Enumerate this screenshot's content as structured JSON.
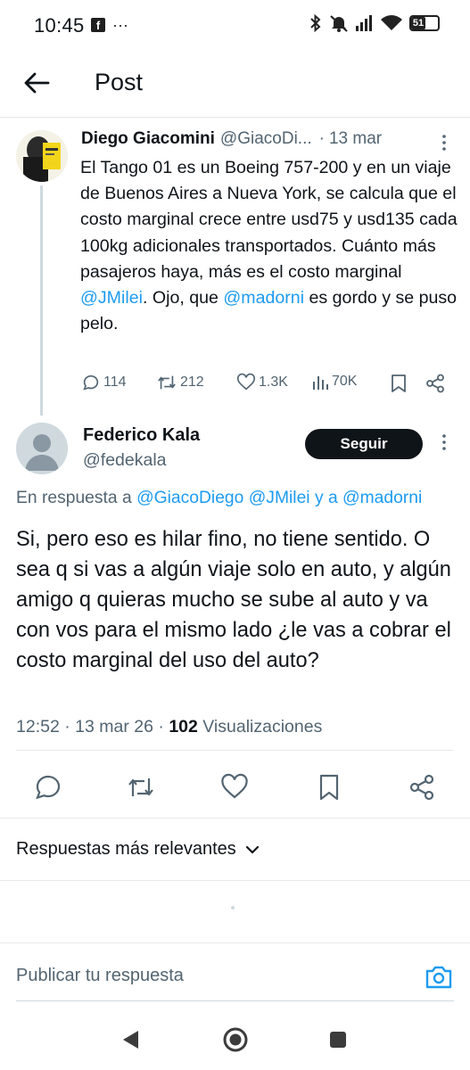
{
  "status_bar": {
    "time": "10:45",
    "fb_glyph": "f",
    "more": "···",
    "battery": "51"
  },
  "header": {
    "title": "Post"
  },
  "original_post": {
    "name": "Diego Giacomini",
    "handle": "@GiacoDi...",
    "date": "13 mar",
    "text_before_mention": "El Tango 01 es un Boeing 757-200 y en un viaje de Buenos Aires a Nueva York, se calcula que el costo marginal crece entre usd75 y usd135 cada 100kg adicionales transportados. Cuánto más pasajeros haya, más es el costo marginal ",
    "mention1": "@JMilei",
    "text_middle": ". Ojo, que ",
    "mention2": "@madorni",
    "text_after": " es gordo y se puso pelo.",
    "stats": {
      "replies": "114",
      "reposts": "212",
      "likes": "1.3K",
      "views": "70K"
    }
  },
  "reply_post": {
    "name": "Federico Kala",
    "handle": "@fedekala",
    "follow_label": "Seguir",
    "reply_prefix": "En respuesta a ",
    "reply_mentions": "@GiacoDiego @JMilei y a @madorni",
    "text": "Si, pero eso es hilar fino, no tiene sentido. O sea q si vas a algún viaje solo en auto, y algún amigo q quieras mucho se sube al auto y va con vos para el mismo lado ¿le vas a cobrar el costo marginal del uso del auto?",
    "time": "12:52",
    "date": "13 mar 26",
    "views_count": "102",
    "views_label": "Visualizaciones"
  },
  "sort": {
    "label": "Respuestas más relevantes"
  },
  "composer": {
    "placeholder": "Publicar tu respuesta"
  },
  "colors": {
    "accent": "#1d9bf0",
    "text": "#0f1419",
    "muted": "#536471",
    "divider": "#e6e9ec"
  }
}
